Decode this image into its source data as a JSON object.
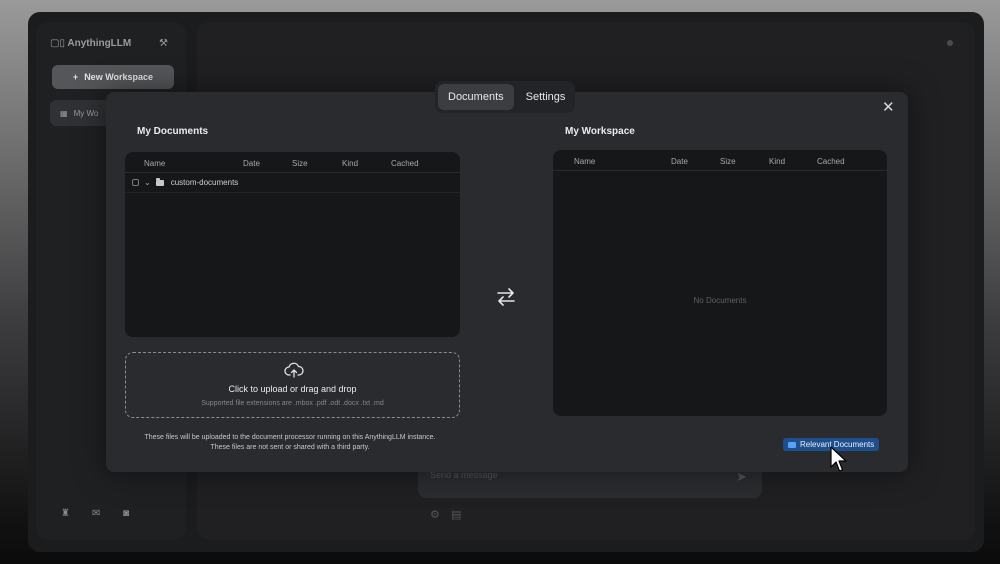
{
  "background": {
    "brand": "AnythingLLM",
    "new_workspace": "New Workspace",
    "workspace_item": "My Wo",
    "chat_placeholder": "Send a message"
  },
  "modal": {
    "tabs": [
      {
        "label": "Documents",
        "active": true
      },
      {
        "label": "Settings",
        "active": false
      }
    ],
    "my_documents": {
      "title": "My Documents",
      "columns": [
        "Name",
        "Date",
        "Size",
        "Kind",
        "Cached"
      ],
      "rows": [
        {
          "name": "custom-documents"
        }
      ]
    },
    "my_workspace": {
      "title": "My Workspace",
      "columns": [
        "Name",
        "Date",
        "Size",
        "Kind",
        "Cached"
      ],
      "empty": "No Documents"
    },
    "upload": {
      "title": "Click to upload or drag and drop",
      "subtitle": "Supported file extensions are .mbox .pdf .odt .docx .txt .md"
    },
    "disclaimer_line1": "These files will be uploaded to the document processor running on this AnythingLLM instance.",
    "disclaimer_line2": "These files are not sent or shared with a third party.",
    "relevant_documents": "Relevant Documents"
  },
  "colors": {
    "modal_bg": "#2a2b2e",
    "panel_bg": "#161719",
    "accent_blue": "#1e4f8c"
  }
}
